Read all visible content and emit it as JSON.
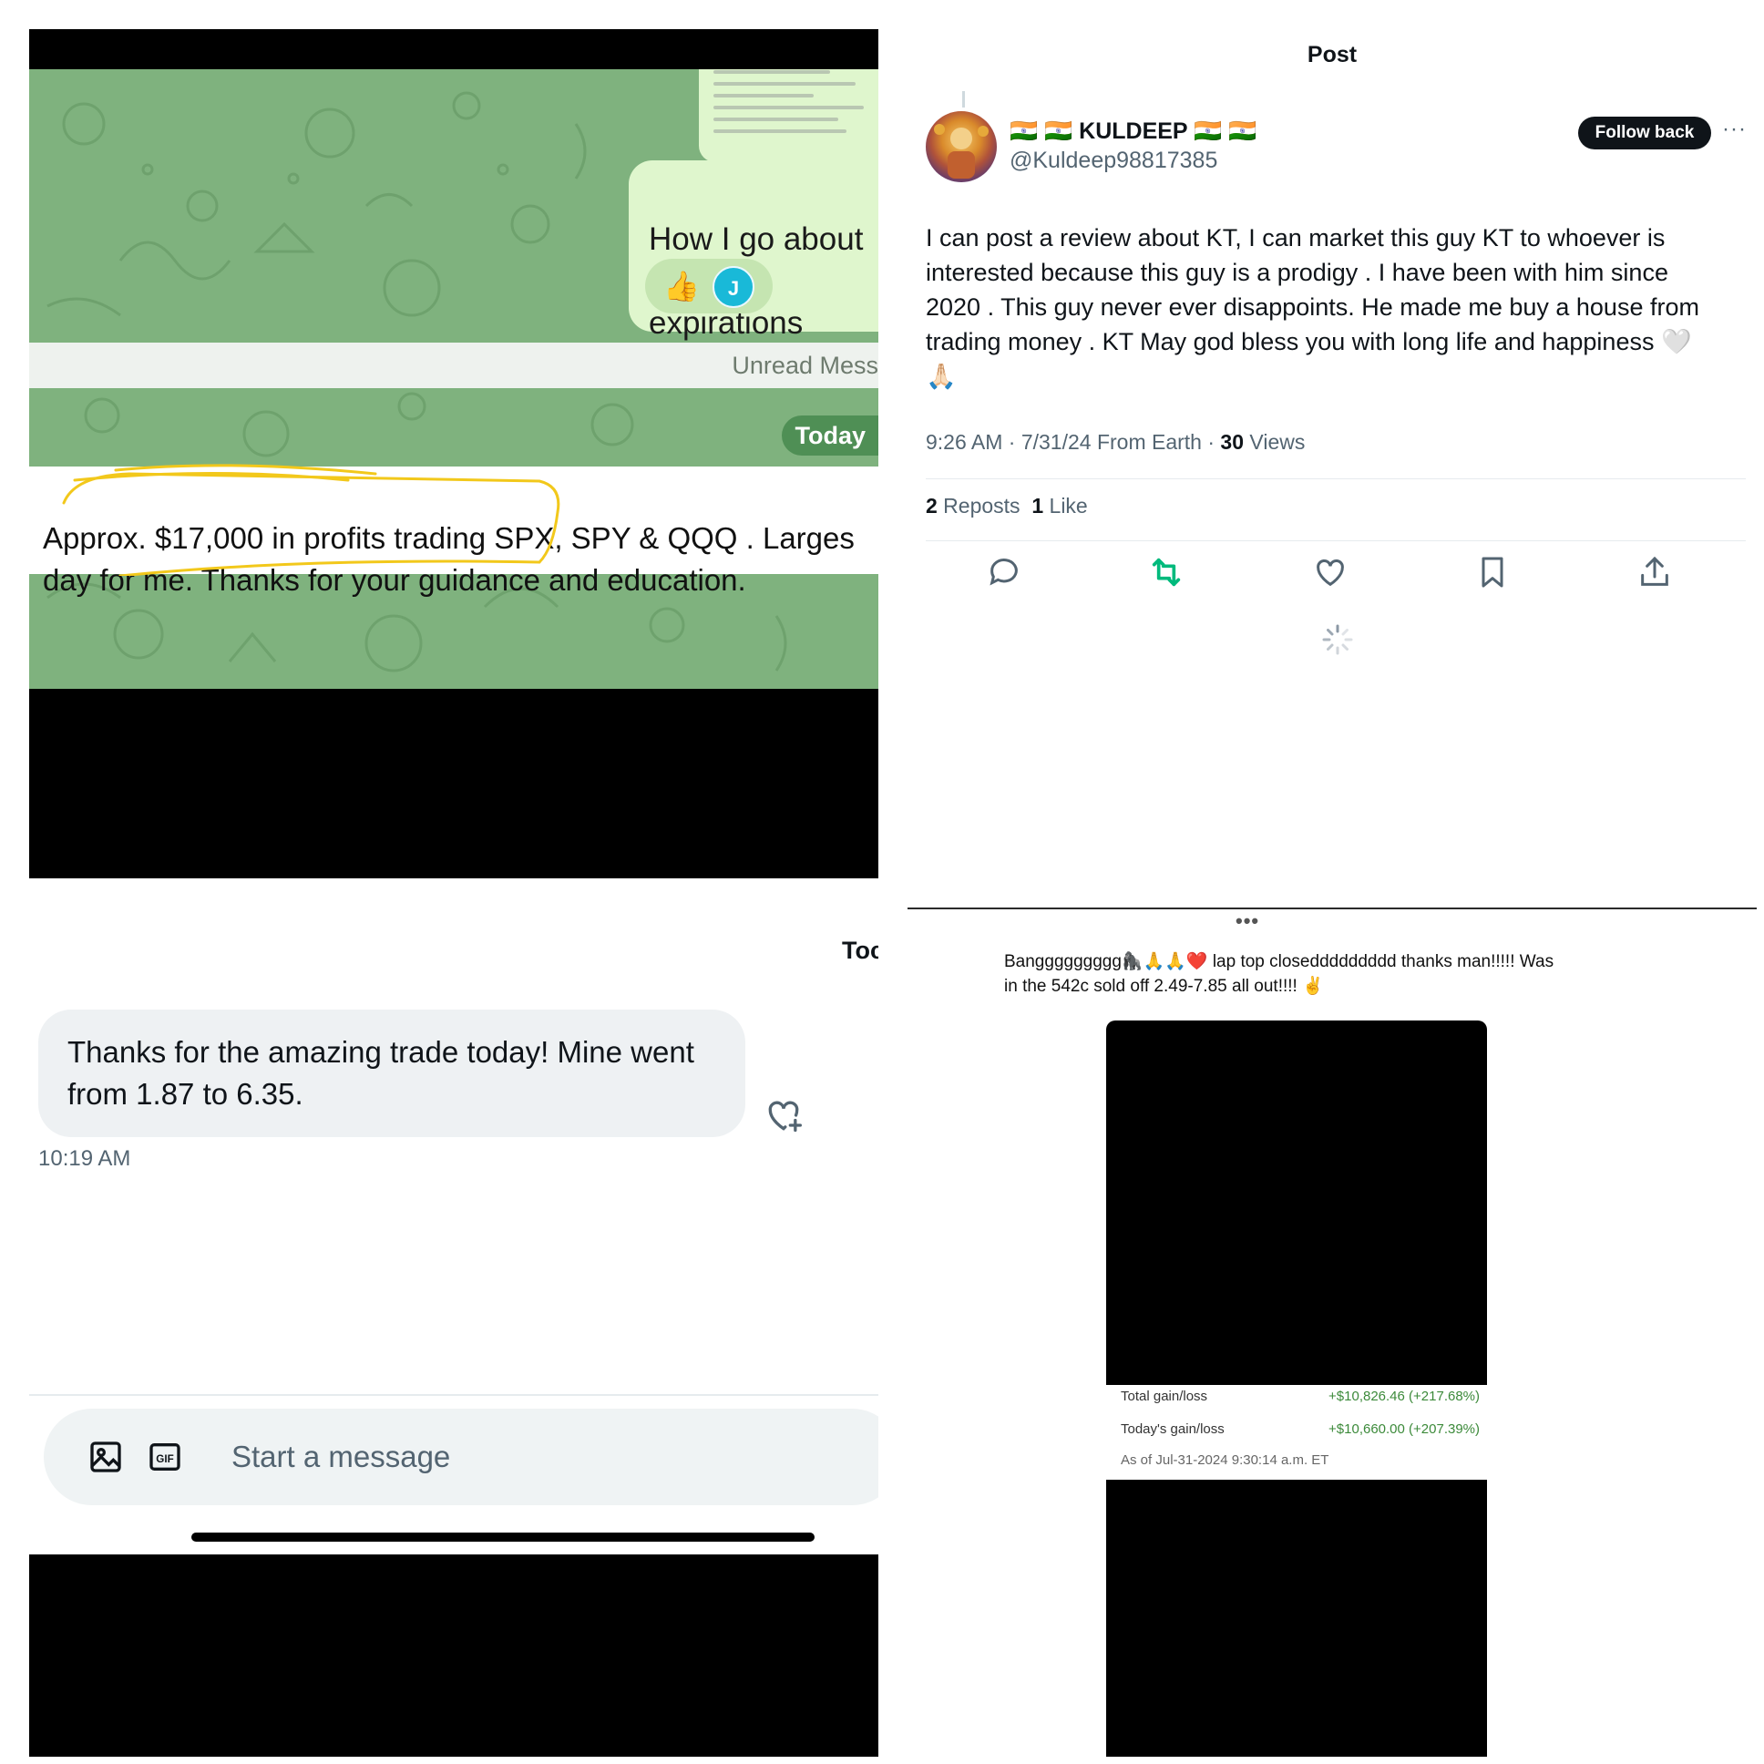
{
  "telegram": {
    "message_partial": "How I go about s\nexpirations",
    "reaction_emoji": "👍",
    "reaction_avatar_letter": "J",
    "unread_label": "Unread Mess",
    "date_badge": "Today",
    "message": "Approx. $17,000 in profits trading SPX, SPY & QQQ . Larges\nday for me. Thanks for your guidance and education.",
    "wallpaper_color": "#7fb27e",
    "highlight_color": "#f2c81b"
  },
  "x_post": {
    "header_title": "Post",
    "author_name": "🇮🇳 🇮🇳 KULDEEP 🇮🇳 🇮🇳",
    "author_handle": "@Kuldeep98817385",
    "follow_button": "Follow back",
    "more_label": "···",
    "text": "I can post a review about KT, I can market this guy KT to whoever is\ninterested because this guy is a prodigy . I have been with him since\n2020 . This guy never ever disappoints. He made me buy a house from\ntrading money . KT May god bless you with long life and happiness 🤍\n🙏🏻",
    "meta_time": "9:26 AM · 7/31/24 From Earth · ",
    "views_count": "30",
    "views_label": " Views",
    "reposts_count": "2",
    "reposts_label": " Reposts",
    "likes_count": "1",
    "likes_label": " Like",
    "action_icons": [
      "reply-icon",
      "repost-icon",
      "like-icon",
      "bookmark-icon",
      "share-icon"
    ],
    "repost_active_color": "#00ba7c"
  },
  "dm": {
    "date_header": "Toc",
    "message": "Thanks for the amazing trade today! Mine went\nfrom 1.87 to 6.35.",
    "time": "10:19 AM",
    "compose_placeholder": "Start a message"
  },
  "comment": {
    "more_label": "•••",
    "text": "Banggggggggg🦍🙏🙏❤️ lap top closeddddddddd thanks man!!!!! Was\nin the 542c sold off 2.49-7.85 all out!!!! ✌️",
    "rows": [
      {
        "label": "Total gain/loss",
        "value": "+$10,826.46 (+217.68%)"
      },
      {
        "label": "Today's gain/loss",
        "value": "+$10,660.00 (+207.39%)"
      }
    ],
    "as_of": "As of Jul-31-2024 9:30:14 a.m. ET",
    "gain_color": "#3c8a3a"
  }
}
